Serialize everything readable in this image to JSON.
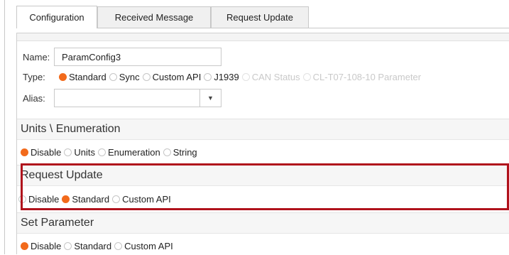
{
  "tabs": [
    {
      "label": "Configuration",
      "active": true
    },
    {
      "label": "Received Message",
      "active": false
    },
    {
      "label": "Request Update",
      "active": false
    }
  ],
  "form": {
    "name_label": "Name:",
    "name_value": "ParamConfig3",
    "type_label": "Type:",
    "type_options": [
      {
        "label": "Standard",
        "selected": true,
        "enabled": true
      },
      {
        "label": "Sync",
        "selected": false,
        "enabled": true
      },
      {
        "label": "Custom API",
        "selected": false,
        "enabled": true
      },
      {
        "label": "J1939",
        "selected": false,
        "enabled": true
      },
      {
        "label": "CAN Status",
        "selected": false,
        "enabled": false
      },
      {
        "label": "CL-T07-108-10 Parameter",
        "selected": false,
        "enabled": false
      }
    ],
    "alias_label": "Alias:",
    "alias_value": "",
    "dropdown_glyph": "▼"
  },
  "sections": {
    "units": {
      "title": "Units \\ Enumeration",
      "options": [
        {
          "label": "Disable",
          "selected": true
        },
        {
          "label": "Units",
          "selected": false
        },
        {
          "label": "Enumeration",
          "selected": false
        },
        {
          "label": "String",
          "selected": false
        }
      ]
    },
    "request_update": {
      "title": "Request Update",
      "options": [
        {
          "label": "Disable",
          "selected": false
        },
        {
          "label": "Standard",
          "selected": true
        },
        {
          "label": "Custom API",
          "selected": false
        }
      ]
    },
    "set_parameter": {
      "title": "Set Parameter",
      "options": [
        {
          "label": "Disable",
          "selected": true
        },
        {
          "label": "Standard",
          "selected": false
        },
        {
          "label": "Custom API",
          "selected": false
        }
      ]
    }
  },
  "colors": {
    "radio_selected": "#f26a1b",
    "highlight_border": "#b0121c"
  }
}
